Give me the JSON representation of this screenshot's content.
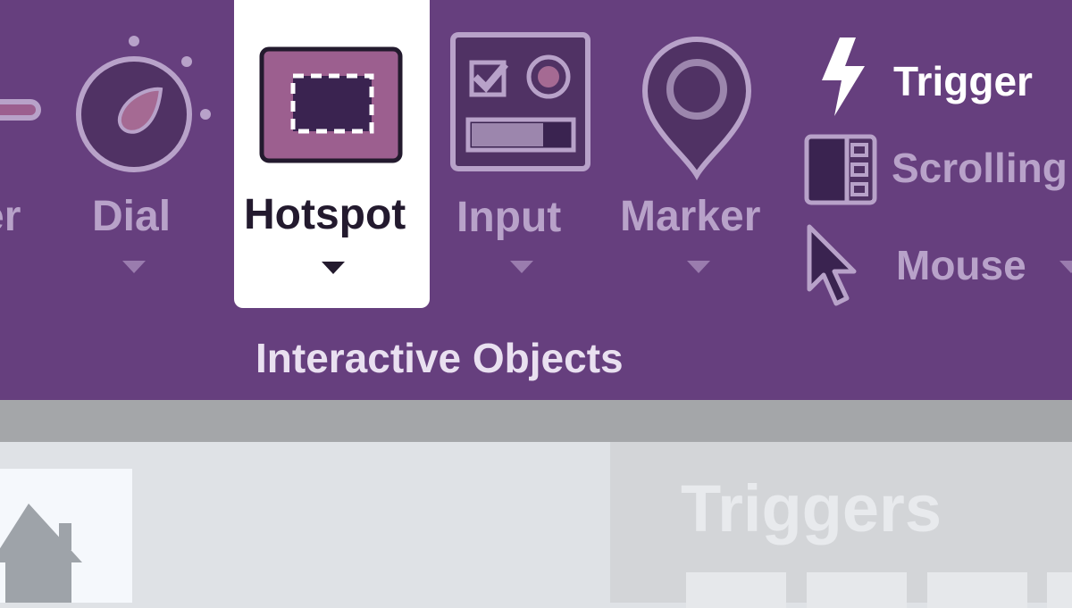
{
  "ribbon": {
    "partial_item_label": "er",
    "items": [
      {
        "label": "Dial",
        "icon": "dial-icon"
      },
      {
        "label": "Hotspot",
        "icon": "hotspot-icon",
        "selected": true
      },
      {
        "label": "Input",
        "icon": "input-icon"
      },
      {
        "label": "Marker",
        "icon": "marker-icon"
      }
    ],
    "side_items": [
      {
        "label": "Trigger",
        "icon": "lightning-icon"
      },
      {
        "label": "Scrolling",
        "icon": "scrolling-panel-icon"
      },
      {
        "label": "Mouse",
        "icon": "mouse-cursor-icon"
      }
    ],
    "group_title": "Interactive Objects"
  },
  "canvas": {
    "panel_title": "Triggers"
  },
  "colors": {
    "ribbon_bg": "#663f7e",
    "active_card": "#ffffff",
    "muted_text": "#b8a2c9",
    "dark_text": "#231a2e"
  }
}
